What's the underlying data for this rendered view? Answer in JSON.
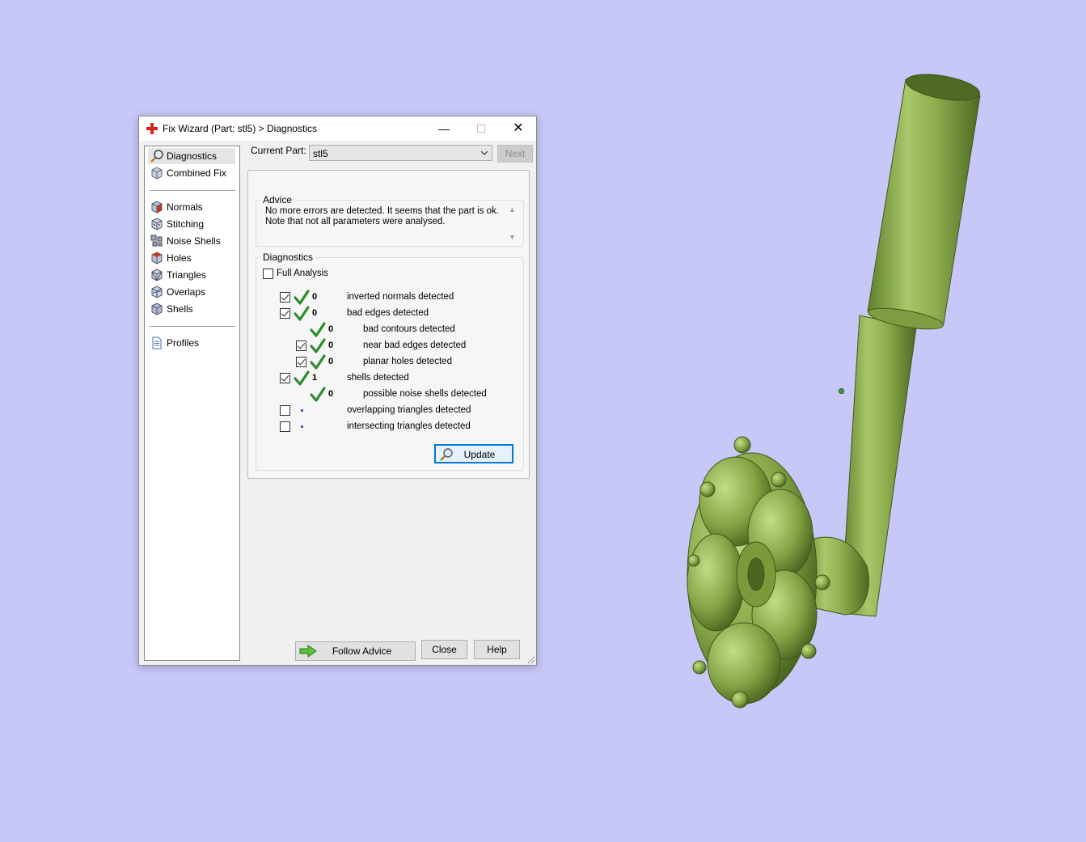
{
  "window": {
    "title": "Fix Wizard (Part: stl5) > Diagnostics",
    "minimize_glyph": "—",
    "maximize_glyph": "☐",
    "close_glyph": "✕"
  },
  "sidebar": {
    "items": [
      {
        "label": "Diagnostics",
        "icon": "magnifier-icon",
        "selected": true
      },
      {
        "label": "Combined Fix",
        "icon": "cube-icon"
      },
      {
        "label": "Normals",
        "icon": "normals-cube-icon"
      },
      {
        "label": "Stitching",
        "icon": "stitching-cube-icon"
      },
      {
        "label": "Noise Shells",
        "icon": "noise-shells-icon"
      },
      {
        "label": "Holes",
        "icon": "holes-cube-icon"
      },
      {
        "label": "Triangles",
        "icon": "triangles-cube-icon"
      },
      {
        "label": "Overlaps",
        "icon": "overlaps-cube-icon"
      },
      {
        "label": "Shells",
        "icon": "shells-cube-icon"
      },
      {
        "label": "Profiles",
        "icon": "document-icon"
      }
    ]
  },
  "header": {
    "current_part_label": "Current Part:",
    "current_part_value": "stl5",
    "next_label": "Next"
  },
  "advice": {
    "title": "Advice",
    "text": "No more errors are detected. It seems that the part is ok. Note that not all parameters were analysed."
  },
  "diagnostics": {
    "title": "Diagnostics",
    "full_analysis_label": "Full Analysis",
    "full_analysis_checked": false,
    "rows": [
      {
        "checkbox": true,
        "checked": true,
        "status": "ok",
        "count": "0",
        "label": "inverted normals detected",
        "indent": 0
      },
      {
        "checkbox": true,
        "checked": true,
        "status": "ok",
        "count": "0",
        "label": "bad edges detected",
        "indent": 0
      },
      {
        "checkbox": false,
        "checked": false,
        "status": "ok",
        "count": "0",
        "label": "bad contours detected",
        "indent": 1
      },
      {
        "checkbox": true,
        "checked": true,
        "status": "ok",
        "count": "0",
        "label": "near bad edges detected",
        "indent": 1
      },
      {
        "checkbox": true,
        "checked": true,
        "status": "ok",
        "count": "0",
        "label": "planar holes detected",
        "indent": 1
      },
      {
        "checkbox": true,
        "checked": true,
        "status": "ok",
        "count": "1",
        "label": "shells detected",
        "indent": 0
      },
      {
        "checkbox": false,
        "checked": false,
        "status": "ok",
        "count": "0",
        "label": "possible noise shells detected",
        "indent": 1
      },
      {
        "checkbox": true,
        "checked": false,
        "status": "none",
        "count": "",
        "label": "overlapping triangles detected",
        "indent": 0
      },
      {
        "checkbox": true,
        "checked": false,
        "status": "none",
        "count": "",
        "label": "intersecting triangles detected",
        "indent": 0
      }
    ],
    "update_label": "Update"
  },
  "footer": {
    "follow_advice_label": "Follow Advice",
    "close_label": "Close",
    "help_label": "Help"
  },
  "colors": {
    "background": "#c8c8f8",
    "model_green": "#8fae4e",
    "check_green": "#2e8b2e",
    "accent_blue": "#0078d7"
  }
}
